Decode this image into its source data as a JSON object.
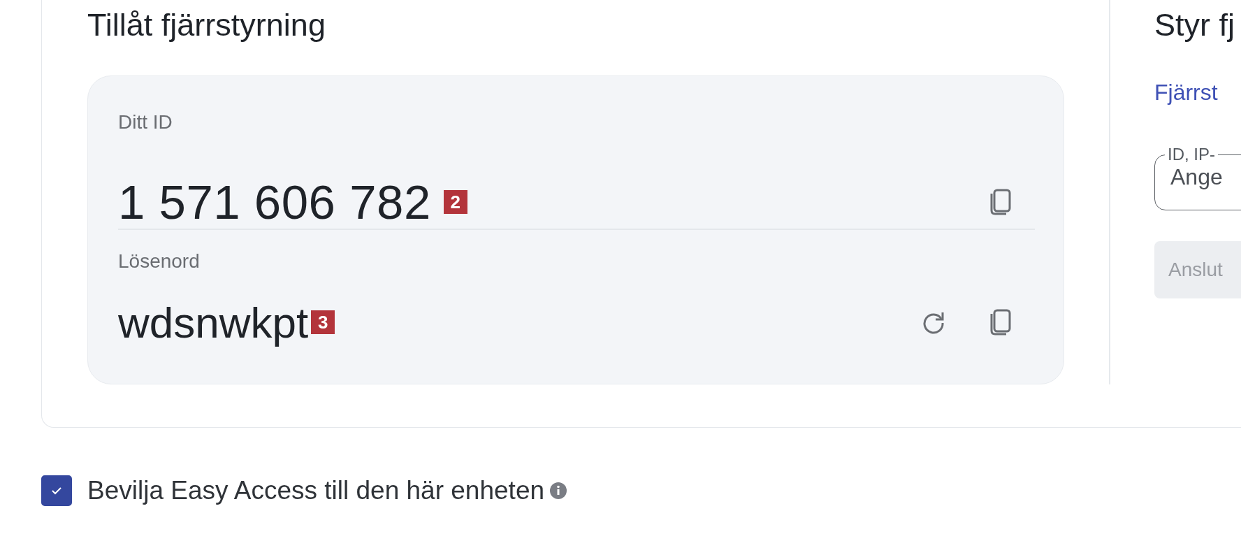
{
  "allow_section": {
    "title": "Tillåt fjärrstyrning",
    "id": {
      "label": "Ditt ID",
      "value": "1 571 606 782",
      "badge": "2"
    },
    "password": {
      "label": "Lösenord",
      "value": "wdsnwkpt",
      "badge": "3"
    }
  },
  "control_section": {
    "title": "Styr fj",
    "link": "Fjärrst",
    "field": {
      "label": "ID, IP-",
      "placeholder": "Ange"
    },
    "connect_button": {
      "label": "Anslut",
      "disabled": true
    }
  },
  "grant": {
    "label": "Bevilja Easy Access till den här enheten",
    "checked": true
  }
}
